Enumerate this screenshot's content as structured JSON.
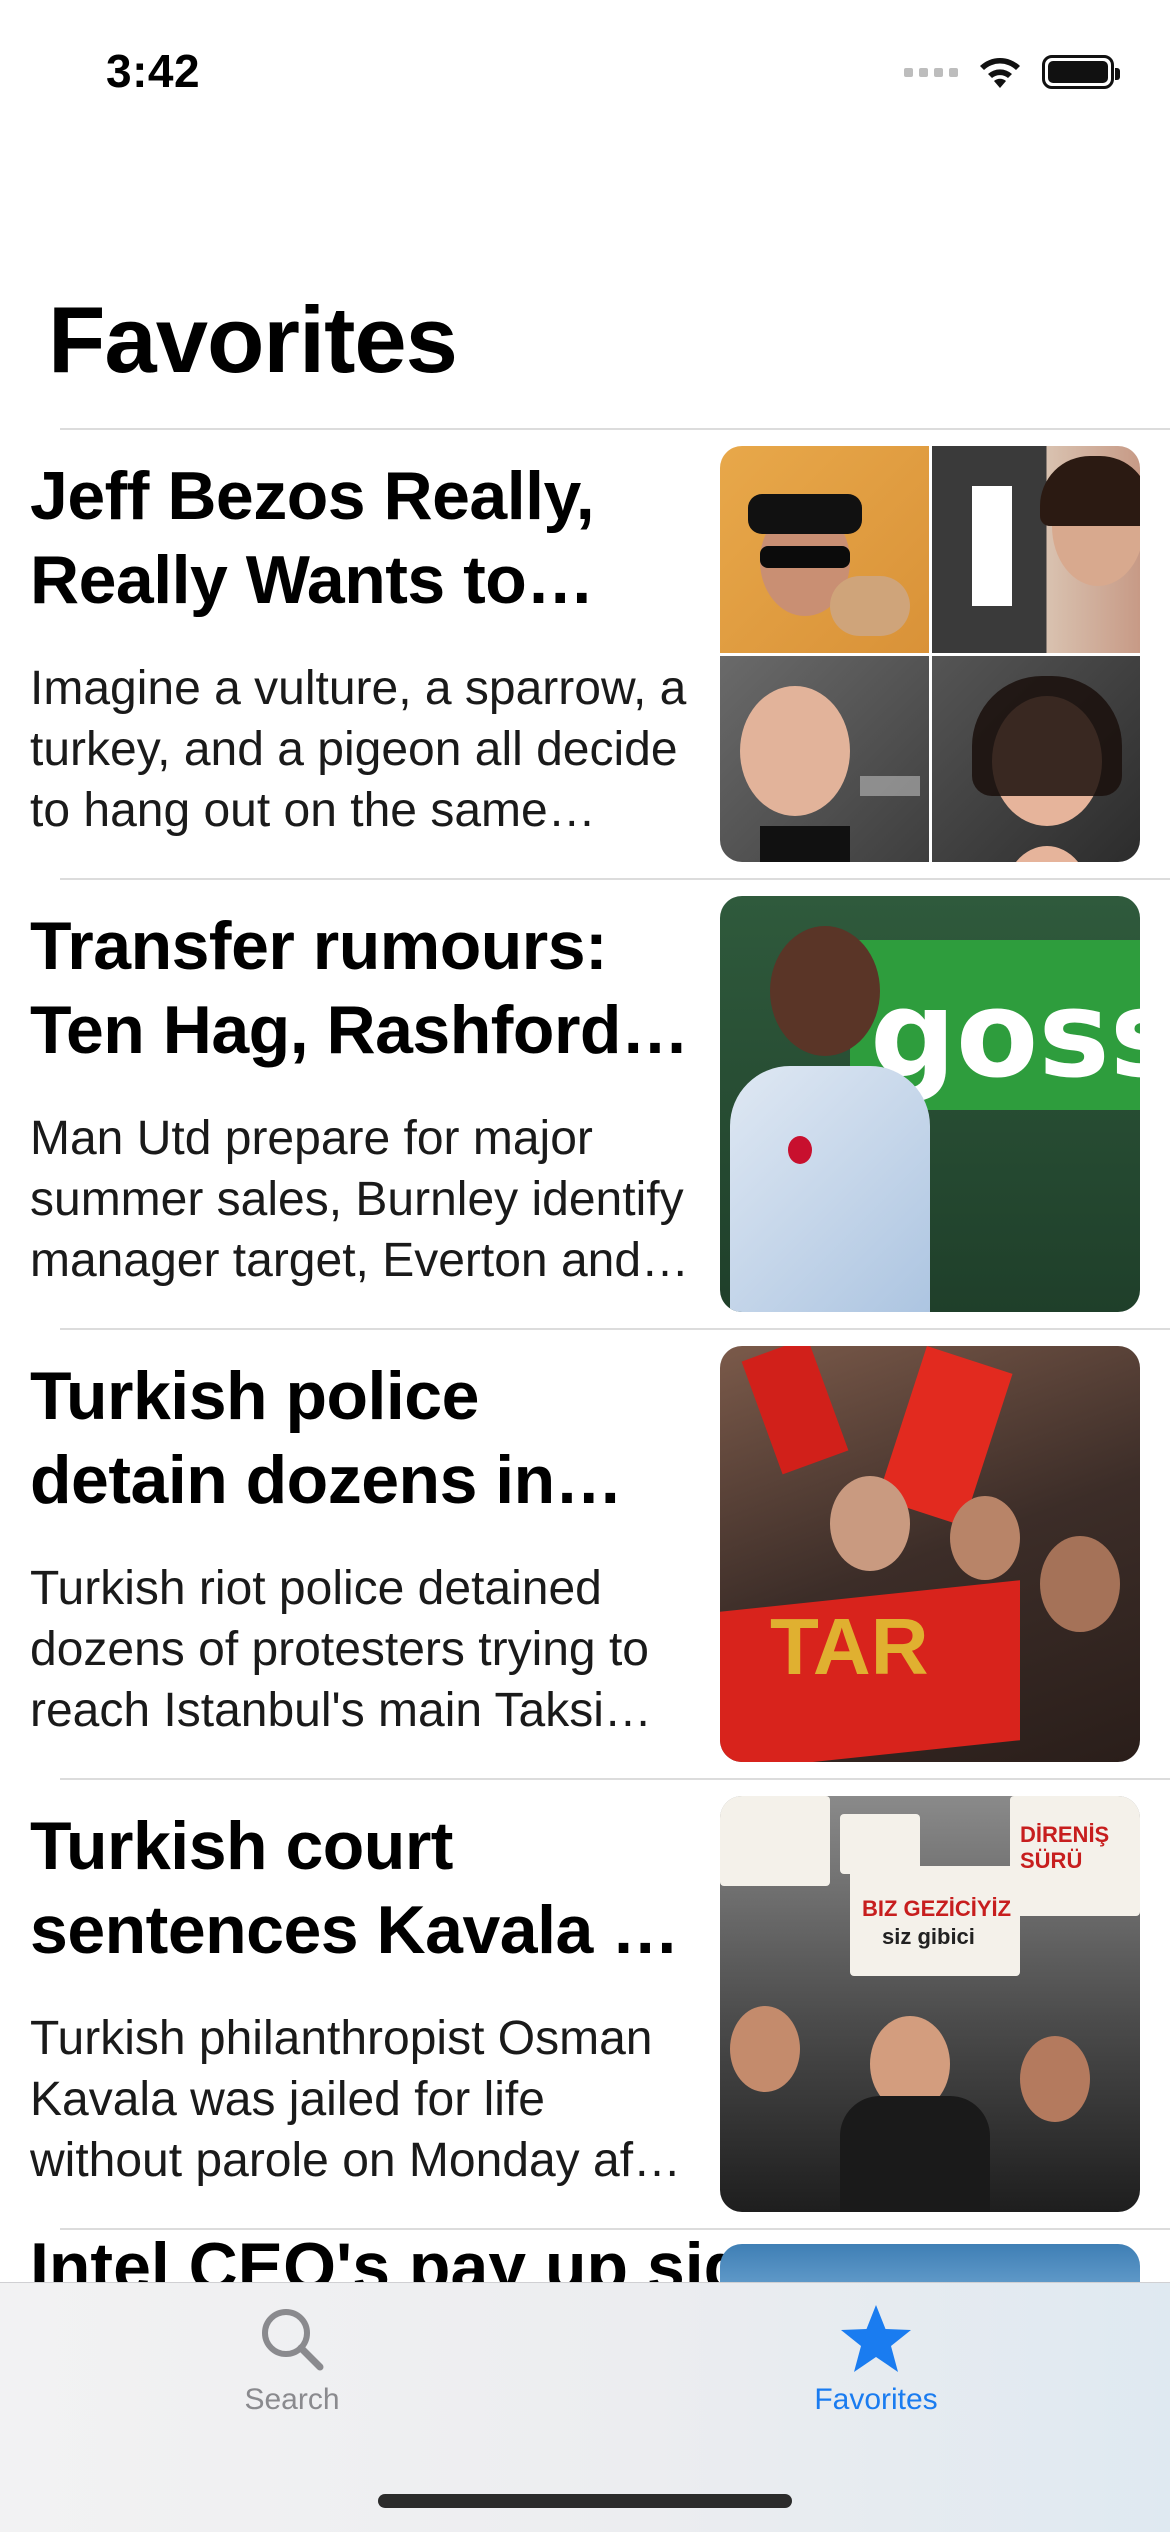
{
  "status_bar": {
    "time": "3:42"
  },
  "page": {
    "title": "Favorites"
  },
  "articles": [
    {
      "title": "Jeff Bezos Really, Really Wants to Have His Own Moon Base",
      "summary": "Imagine a vulture, a sparrow, a turkey, and a pigeon all decide to hang out on the same branch of the same tree"
    },
    {
      "title": "Transfer rumours: Ten Hag, Rashford, Kane, Martinez",
      "summary": "Man Utd prepare for major summer sales, Burnley identify manager target, Everton and Leeds want striker"
    },
    {
      "title": "Turkish police detain dozens in Istanbul May Day rally",
      "summary": "Turkish riot police detained dozens of protesters trying to reach Istanbul's main Taksim Square on May Day"
    },
    {
      "title": "Turkish court sentences Kavala to life in prison",
      "summary": "Turkish philanthropist Osman Kavala was jailed for life without parole on Monday after a court convicted him"
    }
  ],
  "peek_article": {
    "title": "Intel CEO's pay up sign"
  },
  "thumb_text": {
    "gossip": "goss",
    "banner": "TAR",
    "sign_main": "BIZ GEZİCİYİZ",
    "sign_sub": "siz gibici",
    "sign_right": "DİRENİŞ SÜRÜ"
  },
  "tab_bar": {
    "tabs": [
      {
        "label": "Search",
        "icon": "search-icon",
        "selected": false
      },
      {
        "label": "Favorites",
        "icon": "star-icon",
        "selected": true
      }
    ],
    "accent_color": "#1a7cf0",
    "inactive_color": "#8a8a8e"
  }
}
